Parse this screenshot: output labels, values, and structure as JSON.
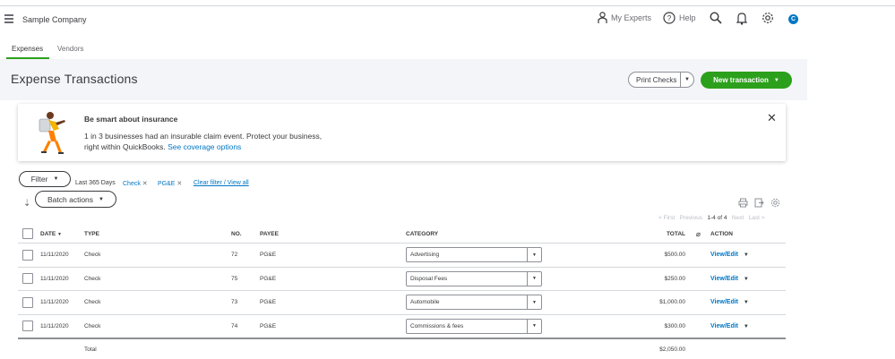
{
  "topbar": {
    "company": "Sample Company",
    "my_experts": "My Experts",
    "help": "Help",
    "avatar": "C"
  },
  "tabs": [
    {
      "label": "Expenses",
      "active": true
    },
    {
      "label": "Vendors",
      "active": false
    }
  ],
  "header": {
    "title": "Expense Transactions",
    "print_checks": "Print Checks",
    "new_transaction": "New transaction"
  },
  "banner": {
    "title": "Be smart about insurance",
    "line1": "1 in 3 businesses had an insurable claim event. Protect your business,",
    "line2": "right within QuickBooks.",
    "link": "See coverage options"
  },
  "filters": {
    "filter_label": "Filter",
    "batch_label": "Batch actions",
    "range": "Last 365 Days",
    "chip_type": "Check",
    "chip_payee": "PG&E",
    "clear": "Clear filter / View all"
  },
  "pager": {
    "first": "< First",
    "previous": "Previous",
    "range": "1-4 of 4",
    "next": "Next",
    "last": "Last >"
  },
  "columns": {
    "date": "DATE",
    "type": "TYPE",
    "no": "NO.",
    "payee": "PAYEE",
    "category": "CATEGORY",
    "total": "TOTAL",
    "action": "ACTION"
  },
  "rows": [
    {
      "date": "11/11/2020",
      "type": "Check",
      "no": "72",
      "payee": "PG&E",
      "category": "Advertising",
      "total": "$500.00",
      "action": "View/Edit"
    },
    {
      "date": "11/11/2020",
      "type": "Check",
      "no": "75",
      "payee": "PG&E",
      "category": "Disposal Fees",
      "total": "$250.00",
      "action": "View/Edit"
    },
    {
      "date": "11/11/2020",
      "type": "Check",
      "no": "73",
      "payee": "PG&E",
      "category": "Automobile",
      "total": "$1,000.00",
      "action": "View/Edit"
    },
    {
      "date": "11/11/2020",
      "type": "Check",
      "no": "74",
      "payee": "PG&E",
      "category": "Commissions & fees",
      "total": "$300.00",
      "action": "View/Edit"
    }
  ],
  "footer": {
    "label": "Total",
    "amount": "$2,050.00"
  },
  "colors": {
    "accent_green": "#2ca01c",
    "link_blue": "#0077c5"
  }
}
